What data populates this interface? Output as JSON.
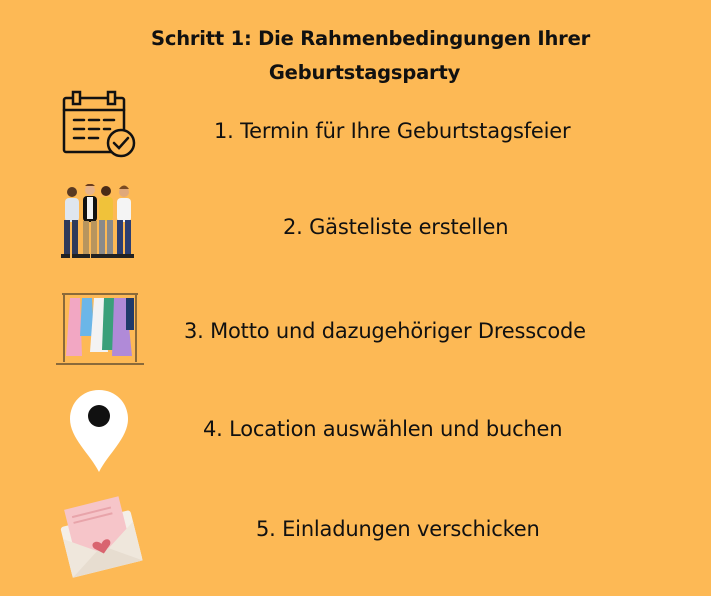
{
  "title": {
    "line1": "Schritt 1: Die Rahmenbedingungen Ihrer",
    "line2": "Geburtstagsparty"
  },
  "items": [
    {
      "label": "1. Termin für Ihre Geburtstagsfeier",
      "icon": "calendar-check-icon"
    },
    {
      "label": "2. Gästeliste erstellen",
      "icon": "people-group-icon"
    },
    {
      "label": "3. Motto und dazugehöriger Dresscode",
      "icon": "clothing-rack-icon"
    },
    {
      "label": "4.  Location auswählen und buchen",
      "icon": "map-pin-icon"
    },
    {
      "label": "5. Einladungen verschicken",
      "icon": "envelope-heart-icon"
    }
  ],
  "colors": {
    "background": "#FDB955",
    "text": "#111111"
  }
}
